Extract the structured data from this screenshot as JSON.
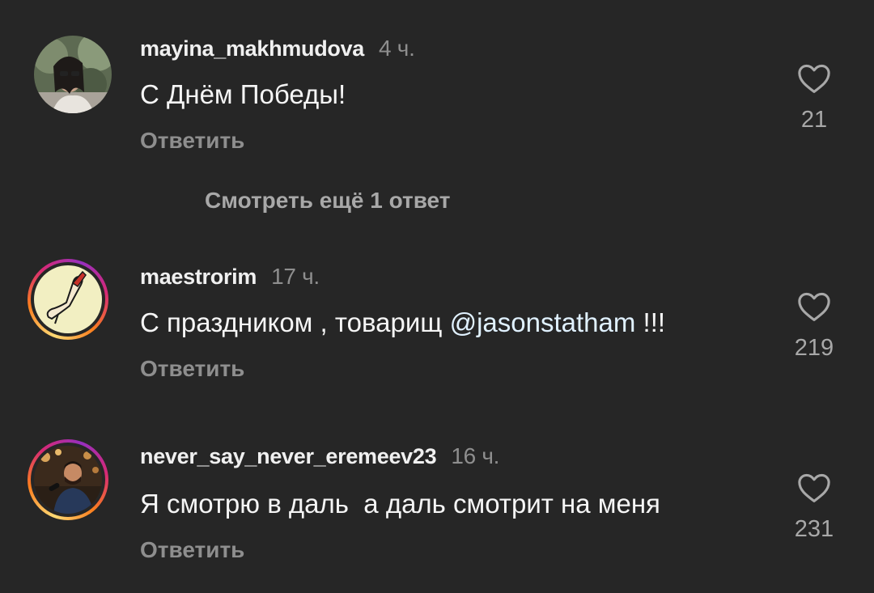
{
  "comments": [
    {
      "username": "mayina_makhmudova",
      "time": "4 ч.",
      "text": "С Днём Победы!",
      "reply_label": "Ответить",
      "likes": "21"
    },
    {
      "username": "maestrorim",
      "time": "17 ч.",
      "text_before": "С праздником , товарищ ",
      "mention": "@jasonstatham",
      "text_after": " !!!",
      "reply_label": "Ответить",
      "likes": "219"
    },
    {
      "username": "never_say_never_eremeev23",
      "time": "16 ч.",
      "text": "Я смотрю в даль  а даль смотрит на меня",
      "reply_label": "Ответить",
      "likes": "231"
    }
  ],
  "view_replies_label": "Смотреть ещё 1 ответ",
  "icons": {
    "like": "heart-outline-icon"
  },
  "colors": {
    "background": "#262626",
    "secondary_text": "#8e8e8e",
    "mention": "#e0f1ff"
  }
}
